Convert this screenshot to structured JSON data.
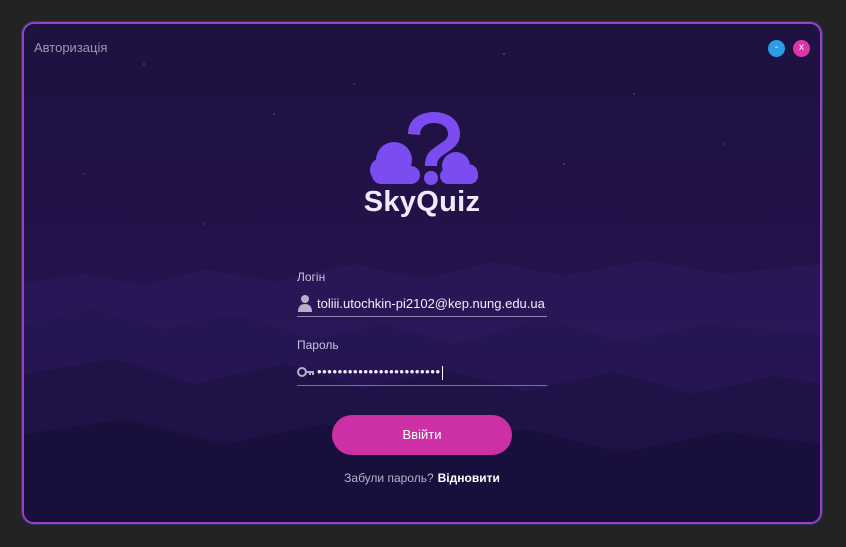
{
  "window": {
    "title": "Авторизація",
    "minimize_label": "-",
    "close_label": "x"
  },
  "brand": {
    "name": "SkyQuiz",
    "logo_icon": "cloud-question-icon"
  },
  "form": {
    "login_label": "Логін",
    "login_value": "toliii.utochkin-pi2102@kep.nung.edu.ua",
    "login_icon": "user-icon",
    "password_label": "Пароль",
    "password_value": "••••••••••••••••••••••••",
    "password_icon": "key-icon",
    "submit_label": "Ввійти",
    "forgot_text": "Забули пароль?",
    "restore_link": "Відновити"
  },
  "colors": {
    "accent": "#cc30a4",
    "minimize": "#2a9de6",
    "close": "#d936a8",
    "logo": "#7b4cf0",
    "focus_underline": "#4a78e8"
  }
}
